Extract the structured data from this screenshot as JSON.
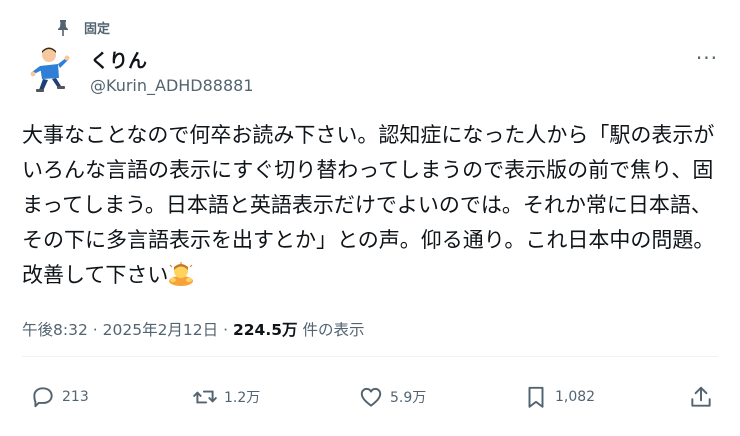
{
  "pinned_label": "固定",
  "author": {
    "display_name": "くりん",
    "handle": "@Kurin_ADHD88881"
  },
  "more_label": "···",
  "tweet_text": "大事なことなので何卒お読み下さい。認知症になった人から「駅の表示がいろんな言語の表示にすぐ切り替わってしまうので表示版の前で焦り、固まってしまう。日本語と英語表示だけでよいのでは。それか常に日本語、その下に多言語表示を出すとか」との声。仰る通り。これ日本中の問題。改善して下さい",
  "emoji": "person-bowing-emoji",
  "meta": {
    "time": "午後8:32",
    "separator": "·",
    "date": "2025年2月12日",
    "views_count": "224.5万",
    "views_label": "件の表示"
  },
  "actions": {
    "replies": "213",
    "reposts": "1.2万",
    "likes": "5.9万",
    "bookmarks": "1,082"
  },
  "icons": [
    "pin-icon",
    "avatar",
    "reply-icon",
    "repost-icon",
    "like-icon",
    "bookmark-icon",
    "share-icon"
  ],
  "colors": {
    "text": "#0f1419",
    "secondary": "#536471",
    "divider": "#eff3f4"
  }
}
